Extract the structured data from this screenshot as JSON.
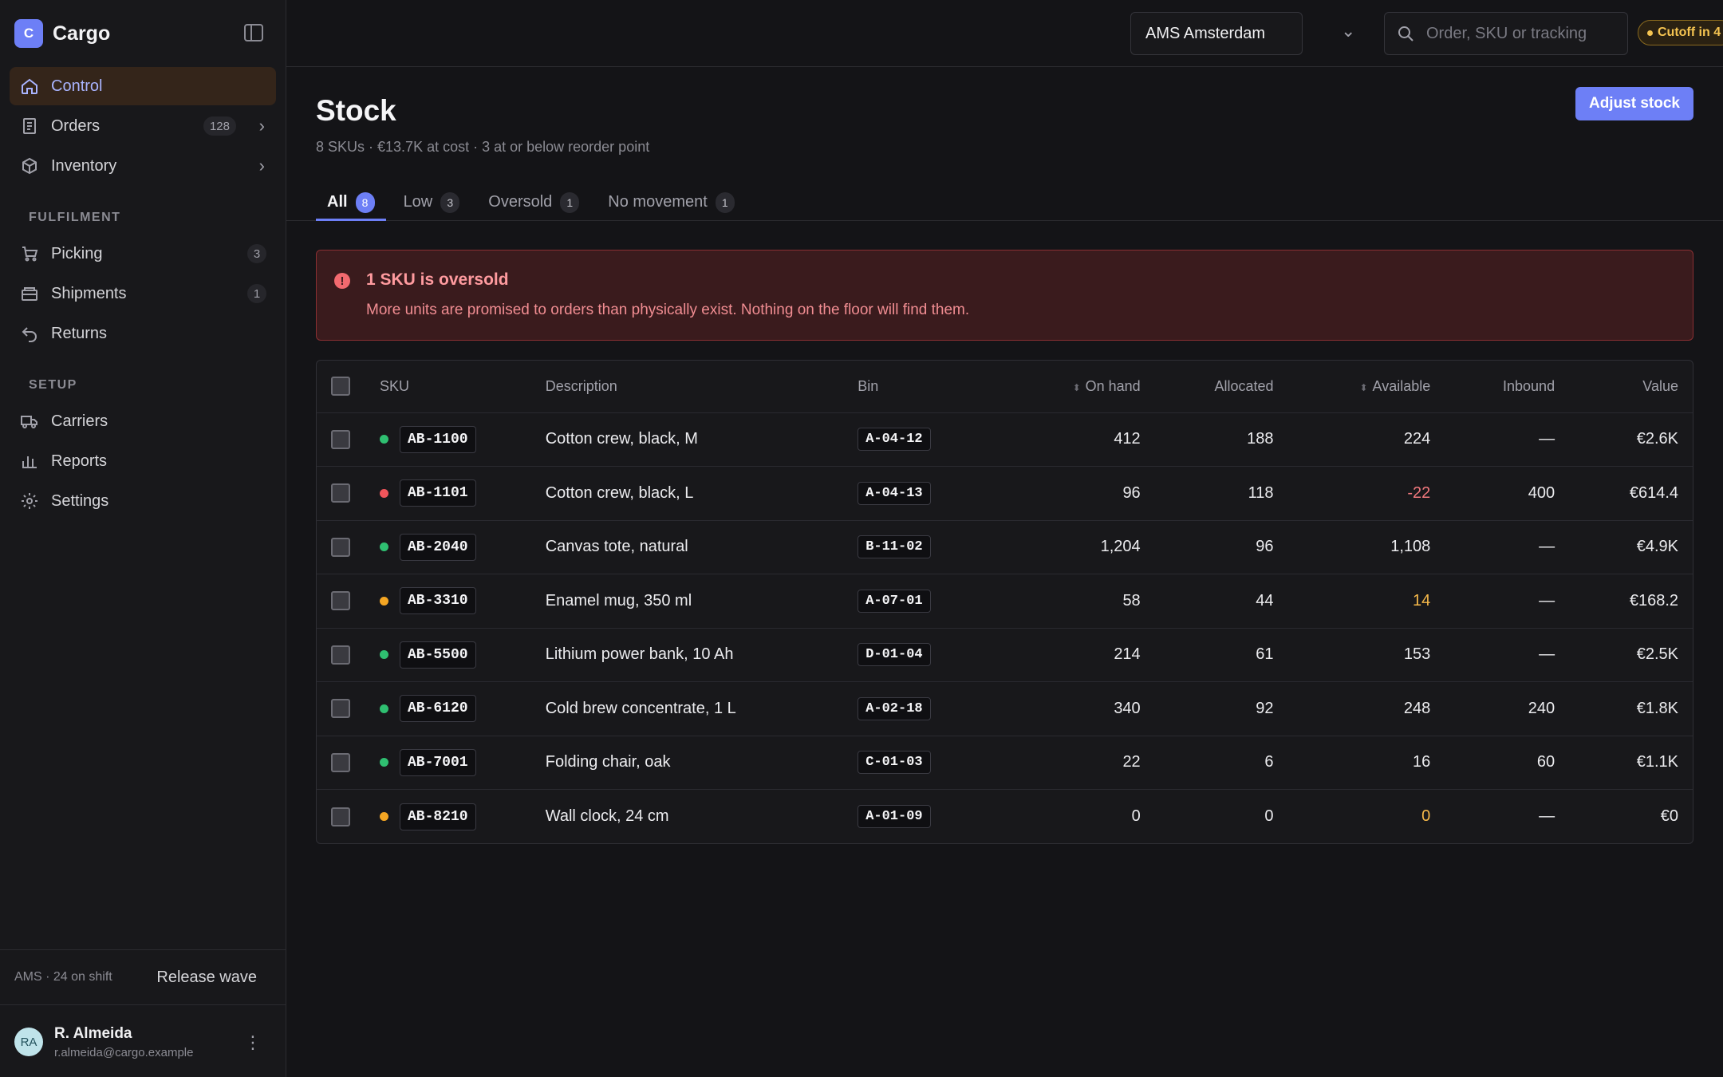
{
  "brand": {
    "initial": "C",
    "name": "Cargo"
  },
  "nav": {
    "primary": [
      {
        "label": "Control",
        "icon": "home-icon",
        "active": true
      },
      {
        "label": "Orders",
        "icon": "document-icon",
        "count": "128",
        "chevron": true
      },
      {
        "label": "Inventory",
        "icon": "box-icon",
        "chevron": true
      }
    ],
    "fulfilment_title": "FULFILMENT",
    "fulfilment": [
      {
        "label": "Picking",
        "icon": "cart-icon",
        "count": "3"
      },
      {
        "label": "Shipments",
        "icon": "package-icon",
        "count": "1"
      },
      {
        "label": "Returns",
        "icon": "return-icon"
      }
    ],
    "setup_title": "SETUP",
    "setup": [
      {
        "label": "Carriers",
        "icon": "truck-icon"
      },
      {
        "label": "Reports",
        "icon": "bar-chart-icon"
      },
      {
        "label": "Settings",
        "icon": "gear-icon"
      }
    ]
  },
  "footer": {
    "shift": "AMS · 24 on shift",
    "release_label": "Release wave"
  },
  "user": {
    "initials": "RA",
    "name": "R. Almeida",
    "email": "r.almeida@cargo.example"
  },
  "topbar": {
    "site": "AMS Amsterdam",
    "search_placeholder": "Order, SKU or tracking",
    "cutoff": "Cutoff in 4"
  },
  "page": {
    "title": "Stock",
    "subtitle": "8 SKUs · €13.7K at cost · 3 at or below reorder point",
    "adjust_label": "Adjust stock"
  },
  "tabs": [
    {
      "label": "All",
      "count": "8",
      "active": true
    },
    {
      "label": "Low",
      "count": "3"
    },
    {
      "label": "Oversold",
      "count": "1"
    },
    {
      "label": "No movement",
      "count": "1"
    }
  ],
  "alert": {
    "title": "1 SKU is oversold",
    "text": "More units are promised to orders than physically exist. Nothing on the floor will find them."
  },
  "colors": {
    "ok": "#2fbf71",
    "danger": "#f0555b",
    "warning": "#f5a623",
    "accent": "#6d7ff6"
  },
  "table": {
    "headers": {
      "sku": "SKU",
      "description": "Description",
      "bin": "Bin",
      "on_hand": "On hand",
      "allocated": "Allocated",
      "available": "Available",
      "inbound": "Inbound",
      "value": "Value"
    },
    "rows": [
      {
        "status": "ok",
        "sku": "AB-1100",
        "description": "Cotton crew, black, M",
        "bin": "A-04-12",
        "on_hand": "412",
        "allocated": "188",
        "available": "224",
        "inbound": "—",
        "value": "€2.6K"
      },
      {
        "status": "danger",
        "sku": "AB-1101",
        "description": "Cotton crew, black, L",
        "bin": "A-04-13",
        "on_hand": "96",
        "allocated": "118",
        "available": "-22",
        "inbound": "400",
        "value": "€614.4"
      },
      {
        "status": "ok",
        "sku": "AB-2040",
        "description": "Canvas tote, natural",
        "bin": "B-11-02",
        "on_hand": "1,204",
        "allocated": "96",
        "available": "1,108",
        "inbound": "—",
        "value": "€4.9K"
      },
      {
        "status": "warning",
        "sku": "AB-3310",
        "description": "Enamel mug, 350 ml",
        "bin": "A-07-01",
        "on_hand": "58",
        "allocated": "44",
        "available": "14",
        "inbound": "—",
        "value": "€168.2"
      },
      {
        "status": "ok",
        "sku": "AB-5500",
        "description": "Lithium power bank, 10 Ah",
        "bin": "D-01-04",
        "on_hand": "214",
        "allocated": "61",
        "available": "153",
        "inbound": "—",
        "value": "€2.5K"
      },
      {
        "status": "ok",
        "sku": "AB-6120",
        "description": "Cold brew concentrate, 1 L",
        "bin": "A-02-18",
        "on_hand": "340",
        "allocated": "92",
        "available": "248",
        "inbound": "240",
        "value": "€1.8K"
      },
      {
        "status": "ok",
        "sku": "AB-7001",
        "description": "Folding chair, oak",
        "bin": "C-01-03",
        "on_hand": "22",
        "allocated": "6",
        "available": "16",
        "inbound": "60",
        "value": "€1.1K"
      },
      {
        "status": "warning",
        "sku": "AB-8210",
        "description": "Wall clock, 24 cm",
        "bin": "A-01-09",
        "on_hand": "0",
        "allocated": "0",
        "available": "0",
        "inbound": "—",
        "value": "€0"
      }
    ]
  }
}
